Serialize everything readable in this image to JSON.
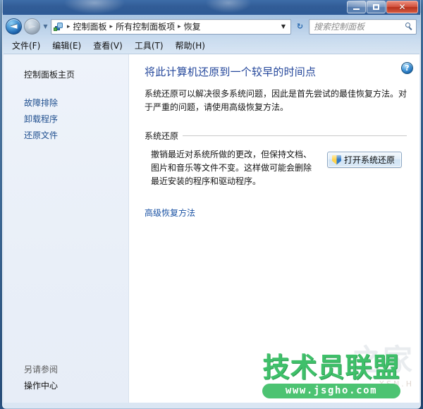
{
  "window": {
    "controls": {
      "minimize_label": "最小化",
      "maximize_label": "最大化",
      "close_label": "✕"
    }
  },
  "navbar": {
    "back_glyph": "◄",
    "forward_glyph": "►",
    "history_chevron": "▼",
    "breadcrumb": [
      {
        "label": "控制面板"
      },
      {
        "label": "所有控制面板项"
      },
      {
        "label": "恢复"
      }
    ],
    "separator": "▸",
    "dropdown_chevron": "▼",
    "refresh_glyph": "↻",
    "search": {
      "placeholder": "搜索控制面板",
      "value": ""
    }
  },
  "menubar": {
    "items": [
      {
        "label": "文件(F)"
      },
      {
        "label": "编辑(E)"
      },
      {
        "label": "查看(V)"
      },
      {
        "label": "工具(T)"
      },
      {
        "label": "帮助(H)"
      }
    ]
  },
  "sidebar": {
    "home": "控制面板主页",
    "links": [
      {
        "label": "故障排除"
      },
      {
        "label": "卸载程序"
      },
      {
        "label": "还原文件"
      }
    ],
    "see_also_heading": "另请参阅",
    "see_also_links": [
      {
        "label": "操作中心"
      }
    ]
  },
  "content": {
    "help_glyph": "?",
    "title": "将此计算机还原到一个较早的时间点",
    "description": "系统还原可以解决很多系统问题，因此是首先尝试的最佳恢复方法。对于严重的问题，请使用高级恢复方法。",
    "section": {
      "heading": "系统还原",
      "body": "撤销最近对系统所做的更改，但保持文档、图片和音乐等文件不变。这样做可能会删除最近安装的程序和驱动程序。",
      "button_label": "打开系统还原"
    },
    "advanced_link": "高级恢复方法"
  },
  "watermark": {
    "primary": "技术员联盟",
    "url": "www.jsgho.com",
    "faint": "之家",
    "faint_sub": "XSN.H"
  },
  "colors": {
    "accent_title": "#24479b",
    "link": "#1b53a4",
    "watermark_green": "#3fc06a",
    "close_red": "#b6311d"
  }
}
